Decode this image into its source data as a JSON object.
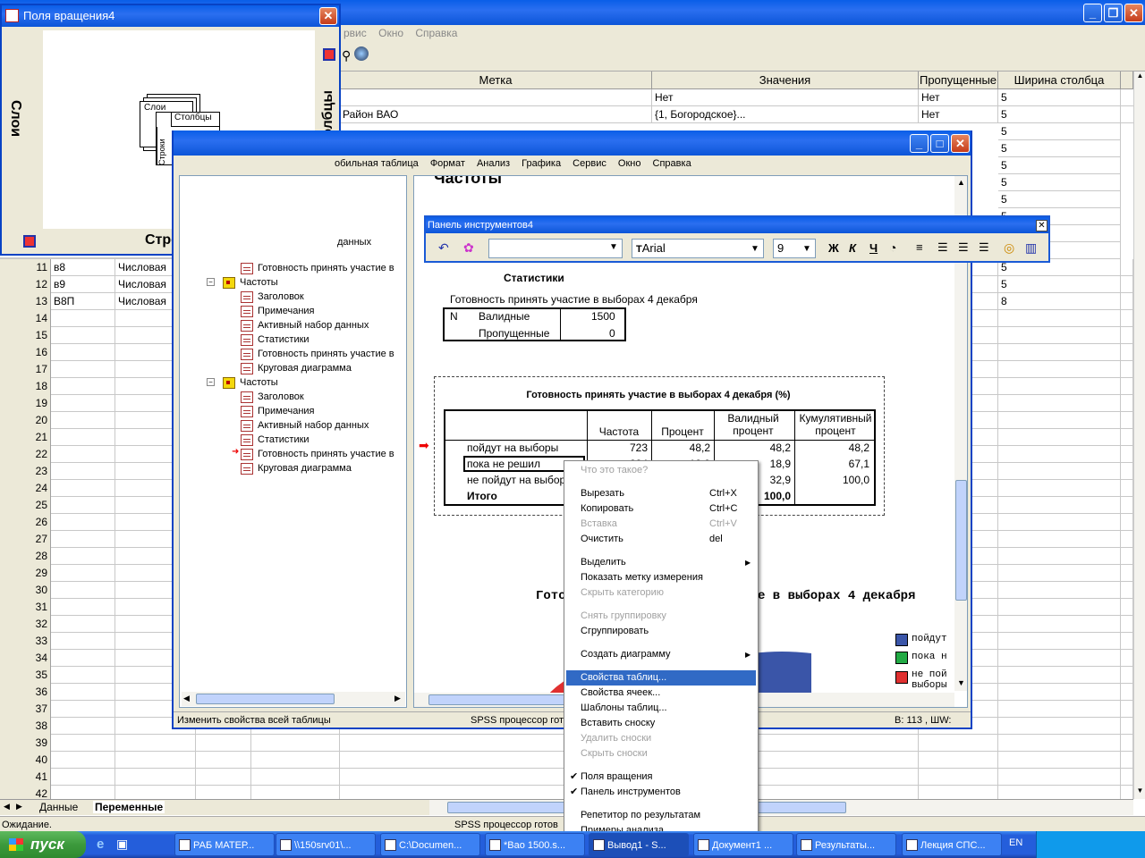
{
  "main_window": {
    "menu": [
      "рвис",
      "Окно",
      "Справка"
    ],
    "columns": [
      "Метка",
      "Значения",
      "Пропущенные",
      "Ширина столбца"
    ],
    "top_rows": [
      {
        "label": "",
        "values": "Нет",
        "missing": "Нет",
        "width": "5"
      },
      {
        "label": "Район ВАО",
        "values": "{1, Богородское}...",
        "missing": "Нет",
        "width": "5"
      }
    ],
    "extra_widths": [
      "5",
      "5",
      "5",
      "5",
      "5",
      "5",
      "5",
      "5"
    ],
    "var_rows": [
      {
        "num": "11",
        "name": "в8",
        "type": "Числовая",
        "width": "5"
      },
      {
        "num": "12",
        "name": "в9",
        "type": "Числовая",
        "width": "5"
      },
      {
        "num": "13",
        "name": "В8П",
        "type": "Числовая",
        "width": "8"
      }
    ],
    "empty_rows": [
      "14",
      "15",
      "16",
      "17",
      "18",
      "19",
      "20",
      "21",
      "22",
      "23",
      "24",
      "25",
      "26",
      "27",
      "28",
      "29",
      "30",
      "31",
      "32",
      "33",
      "34",
      "35",
      "36",
      "37",
      "38",
      "39",
      "40",
      "41",
      "42"
    ],
    "partial_rows": [
      "данных"
    ],
    "sheet_tabs": {
      "data": "Данные",
      "vars": "Переменные"
    },
    "status_left": "Ожидание.",
    "status_center": "SPSS процессор готов"
  },
  "pivot_window": {
    "title": "Поля вращения4",
    "layers": "Слои",
    "columns": "Столбцы",
    "rows": "Строки",
    "diagram": {
      "layers": "Слои",
      "columns": "Столбцы",
      "rows": "Строки"
    }
  },
  "output_window": {
    "menu": [
      "обильная таблица",
      "Формат",
      "Анализ",
      "Графика",
      "Сервис",
      "Окно",
      "Справка"
    ],
    "tree": [
      {
        "label": "Готовность принять участие в",
        "type": "table"
      },
      {
        "label": "Частоты",
        "type": "book"
      },
      {
        "label": "Заголовок",
        "type": "table"
      },
      {
        "label": "Примечания",
        "type": "table"
      },
      {
        "label": "Активный набор данных",
        "type": "table"
      },
      {
        "label": "Статистики",
        "type": "table"
      },
      {
        "label": "Готовность принять участие в",
        "type": "table"
      },
      {
        "label": "Круговая диаграмма",
        "type": "chart"
      },
      {
        "label": "Частоты",
        "type": "book"
      },
      {
        "label": "Заголовок",
        "type": "table"
      },
      {
        "label": "Примечания",
        "type": "table"
      },
      {
        "label": "Активный набор данных",
        "type": "table"
      },
      {
        "label": "Статистики",
        "type": "table"
      },
      {
        "label": "Готовность принять участие в",
        "type": "table"
      },
      {
        "label": "Круговая диаграмма",
        "type": "chart"
      }
    ],
    "heading": "Частоты",
    "stats_title": "Статистики",
    "stats_subtitle": "Готовность принять участие в выборах 4 декабря",
    "stats": {
      "n": "N",
      "valid": "Валидные",
      "valid_value": "1500",
      "missing": "Пропущенные",
      "missing_value": "0"
    },
    "freq_title": "Готовность принять участие в выборах 4 декабря (%)",
    "freq_headers": [
      "Частота",
      "Процент",
      "Валидный процент",
      "Кумулятивный процент"
    ],
    "freq_rows": [
      {
        "label": "пойдут на выборы",
        "freq": "723",
        "pct": "48,2",
        "vpct": "48,2",
        "cum": "48,2"
      },
      {
        "label": "пока не решил",
        "freq": "284",
        "pct": "18,9",
        "vpct": "18,9",
        "cum": "67,1"
      },
      {
        "label": "не пойдут на выборы",
        "freq": "",
        "pct": "",
        "vpct": "32,9",
        "cum": "100,0"
      },
      {
        "label": "Итого",
        "freq": "",
        "pct": "",
        "vpct": "100,0",
        "cum": ""
      }
    ],
    "chart_title_left": "Гото",
    "chart_title_right": "е в выборах 4 декабря",
    "legend": [
      {
        "label": "пойдут",
        "color": "#3a55a8"
      },
      {
        "label": "пока н",
        "color": "#22aa44"
      },
      {
        "label": "не пой",
        "color": "#e03030"
      },
      {
        "label": "выборы",
        "color": ""
      }
    ],
    "status_left": "Изменить свойства всей таблицы",
    "status_center": "SPSS процессор готов",
    "status_right": "В: 113 , ШW:"
  },
  "toolbar_panel": {
    "title": "Панель инструментов4",
    "font": "Arial",
    "size": "9"
  },
  "context_menu": {
    "items": [
      {
        "label": "Что это такое?",
        "shortcut": "",
        "disabled": true
      },
      {
        "sep": true
      },
      {
        "label": "Вырезать",
        "shortcut": "Ctrl+X"
      },
      {
        "label": "Копировать",
        "shortcut": "Ctrl+C"
      },
      {
        "label": "Вставка",
        "shortcut": "Ctrl+V",
        "disabled": true
      },
      {
        "label": "Очистить",
        "shortcut": "del"
      },
      {
        "sep": true
      },
      {
        "label": "Выделить",
        "submenu": true
      },
      {
        "label": "Показать метку измерения"
      },
      {
        "label": "Скрыть категорию",
        "disabled": true
      },
      {
        "sep": true
      },
      {
        "label": "Снять группировку",
        "disabled": true
      },
      {
        "label": "Сгруппировать"
      },
      {
        "sep": true
      },
      {
        "label": "Создать диаграмму",
        "submenu": true
      },
      {
        "sep": true
      },
      {
        "label": "Свойства таблиц...",
        "highlight": true
      },
      {
        "label": "Свойства ячеек..."
      },
      {
        "label": "Шаблоны таблиц..."
      },
      {
        "label": "Вставить сноску"
      },
      {
        "label": "Удалить сноски",
        "disabled": true
      },
      {
        "label": "Скрыть сноски",
        "disabled": true
      },
      {
        "sep": true
      },
      {
        "label": "Поля вращения",
        "checked": true
      },
      {
        "label": "Панель инструментов",
        "checked": true
      },
      {
        "sep": true
      },
      {
        "label": "Репетитор по результатам"
      },
      {
        "label": "Примеры анализа"
      }
    ]
  },
  "taskbar": {
    "start": "пуск",
    "tasks": [
      "РАБ МАТЕР...",
      "\\\\150srv01\\...",
      "C:\\Documen...",
      "*Вао 1500.s...",
      "Вывод1 - S...",
      "Документ1 ...",
      "Результаты...",
      "Лекция СПС..."
    ],
    "lang": "EN"
  }
}
